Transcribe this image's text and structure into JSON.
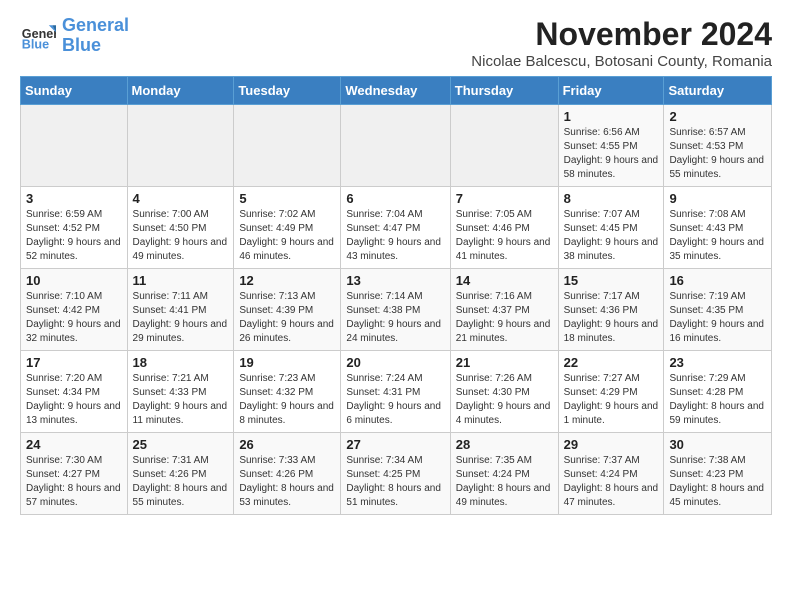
{
  "header": {
    "logo_line1": "General",
    "logo_line2": "Blue",
    "title": "November 2024",
    "subtitle": "Nicolae Balcescu, Botosani County, Romania"
  },
  "calendar": {
    "headers": [
      "Sunday",
      "Monday",
      "Tuesday",
      "Wednesday",
      "Thursday",
      "Friday",
      "Saturday"
    ],
    "weeks": [
      [
        {
          "day": "",
          "content": ""
        },
        {
          "day": "",
          "content": ""
        },
        {
          "day": "",
          "content": ""
        },
        {
          "day": "",
          "content": ""
        },
        {
          "day": "",
          "content": ""
        },
        {
          "day": "1",
          "content": "Sunrise: 6:56 AM\nSunset: 4:55 PM\nDaylight: 9 hours and 58 minutes."
        },
        {
          "day": "2",
          "content": "Sunrise: 6:57 AM\nSunset: 4:53 PM\nDaylight: 9 hours and 55 minutes."
        }
      ],
      [
        {
          "day": "3",
          "content": "Sunrise: 6:59 AM\nSunset: 4:52 PM\nDaylight: 9 hours and 52 minutes."
        },
        {
          "day": "4",
          "content": "Sunrise: 7:00 AM\nSunset: 4:50 PM\nDaylight: 9 hours and 49 minutes."
        },
        {
          "day": "5",
          "content": "Sunrise: 7:02 AM\nSunset: 4:49 PM\nDaylight: 9 hours and 46 minutes."
        },
        {
          "day": "6",
          "content": "Sunrise: 7:04 AM\nSunset: 4:47 PM\nDaylight: 9 hours and 43 minutes."
        },
        {
          "day": "7",
          "content": "Sunrise: 7:05 AM\nSunset: 4:46 PM\nDaylight: 9 hours and 41 minutes."
        },
        {
          "day": "8",
          "content": "Sunrise: 7:07 AM\nSunset: 4:45 PM\nDaylight: 9 hours and 38 minutes."
        },
        {
          "day": "9",
          "content": "Sunrise: 7:08 AM\nSunset: 4:43 PM\nDaylight: 9 hours and 35 minutes."
        }
      ],
      [
        {
          "day": "10",
          "content": "Sunrise: 7:10 AM\nSunset: 4:42 PM\nDaylight: 9 hours and 32 minutes."
        },
        {
          "day": "11",
          "content": "Sunrise: 7:11 AM\nSunset: 4:41 PM\nDaylight: 9 hours and 29 minutes."
        },
        {
          "day": "12",
          "content": "Sunrise: 7:13 AM\nSunset: 4:39 PM\nDaylight: 9 hours and 26 minutes."
        },
        {
          "day": "13",
          "content": "Sunrise: 7:14 AM\nSunset: 4:38 PM\nDaylight: 9 hours and 24 minutes."
        },
        {
          "day": "14",
          "content": "Sunrise: 7:16 AM\nSunset: 4:37 PM\nDaylight: 9 hours and 21 minutes."
        },
        {
          "day": "15",
          "content": "Sunrise: 7:17 AM\nSunset: 4:36 PM\nDaylight: 9 hours and 18 minutes."
        },
        {
          "day": "16",
          "content": "Sunrise: 7:19 AM\nSunset: 4:35 PM\nDaylight: 9 hours and 16 minutes."
        }
      ],
      [
        {
          "day": "17",
          "content": "Sunrise: 7:20 AM\nSunset: 4:34 PM\nDaylight: 9 hours and 13 minutes."
        },
        {
          "day": "18",
          "content": "Sunrise: 7:21 AM\nSunset: 4:33 PM\nDaylight: 9 hours and 11 minutes."
        },
        {
          "day": "19",
          "content": "Sunrise: 7:23 AM\nSunset: 4:32 PM\nDaylight: 9 hours and 8 minutes."
        },
        {
          "day": "20",
          "content": "Sunrise: 7:24 AM\nSunset: 4:31 PM\nDaylight: 9 hours and 6 minutes."
        },
        {
          "day": "21",
          "content": "Sunrise: 7:26 AM\nSunset: 4:30 PM\nDaylight: 9 hours and 4 minutes."
        },
        {
          "day": "22",
          "content": "Sunrise: 7:27 AM\nSunset: 4:29 PM\nDaylight: 9 hours and 1 minute."
        },
        {
          "day": "23",
          "content": "Sunrise: 7:29 AM\nSunset: 4:28 PM\nDaylight: 8 hours and 59 minutes."
        }
      ],
      [
        {
          "day": "24",
          "content": "Sunrise: 7:30 AM\nSunset: 4:27 PM\nDaylight: 8 hours and 57 minutes."
        },
        {
          "day": "25",
          "content": "Sunrise: 7:31 AM\nSunset: 4:26 PM\nDaylight: 8 hours and 55 minutes."
        },
        {
          "day": "26",
          "content": "Sunrise: 7:33 AM\nSunset: 4:26 PM\nDaylight: 8 hours and 53 minutes."
        },
        {
          "day": "27",
          "content": "Sunrise: 7:34 AM\nSunset: 4:25 PM\nDaylight: 8 hours and 51 minutes."
        },
        {
          "day": "28",
          "content": "Sunrise: 7:35 AM\nSunset: 4:24 PM\nDaylight: 8 hours and 49 minutes."
        },
        {
          "day": "29",
          "content": "Sunrise: 7:37 AM\nSunset: 4:24 PM\nDaylight: 8 hours and 47 minutes."
        },
        {
          "day": "30",
          "content": "Sunrise: 7:38 AM\nSunset: 4:23 PM\nDaylight: 8 hours and 45 minutes."
        }
      ]
    ]
  }
}
